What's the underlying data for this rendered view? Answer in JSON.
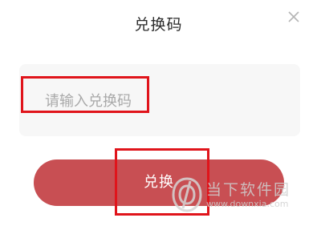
{
  "dialog": {
    "title": "兑换码",
    "close_icon": "close-icon",
    "input": {
      "placeholder": "请输入兑换码",
      "value": ""
    },
    "submit_label": "兑换"
  },
  "watermark": {
    "text": "当下软件园",
    "url": "www.downxia.com"
  },
  "colors": {
    "button": "#c84f53",
    "highlight": "#e0141b",
    "input_bg": "#f7f7f7"
  }
}
